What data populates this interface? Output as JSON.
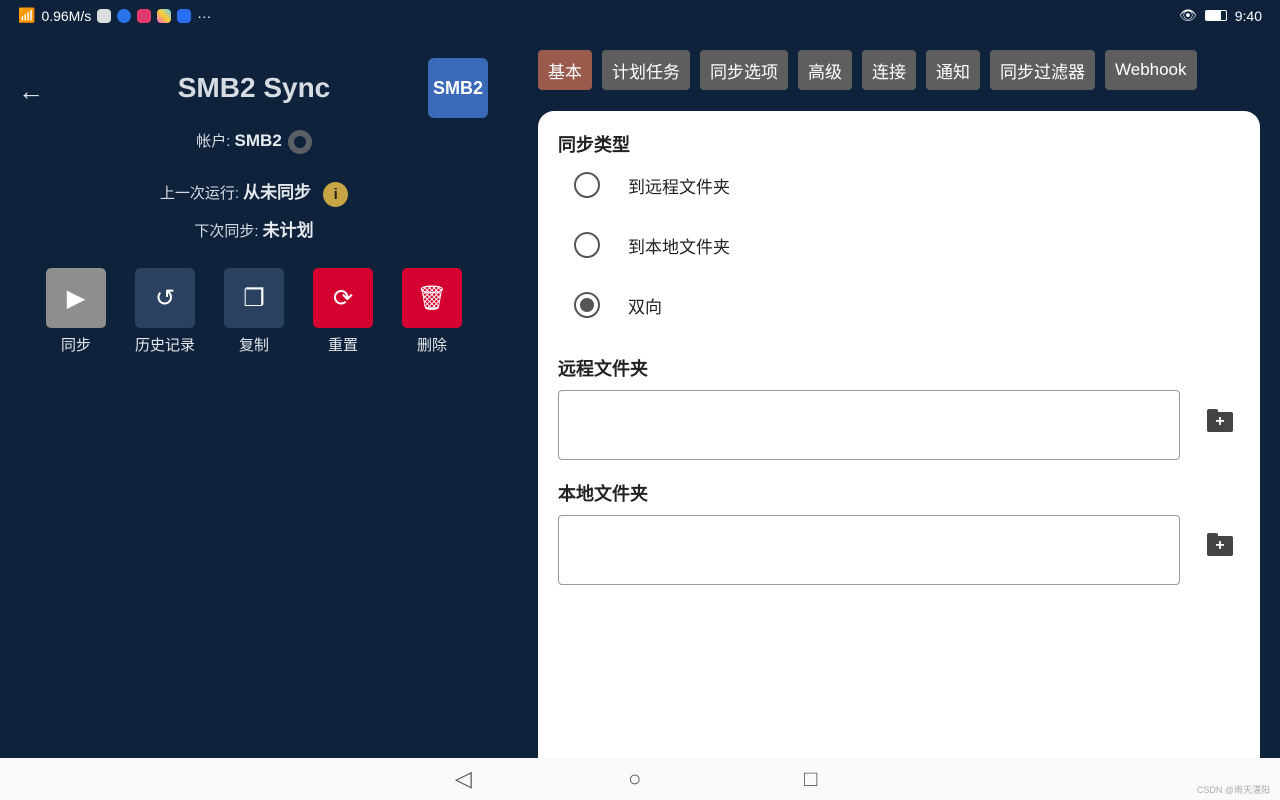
{
  "status": {
    "speed": "0.96M/s",
    "more": "···",
    "time": "9:40"
  },
  "header": {
    "title": "SMB2 Sync",
    "badge": "SMB2"
  },
  "account": {
    "label": "帐户:",
    "value": "SMB2"
  },
  "last_run": {
    "label": "上一次运行:",
    "value": "从未同步"
  },
  "next_sync": {
    "label": "下次同步:",
    "value": "未计划"
  },
  "actions": [
    {
      "label": "同步",
      "color": "#8e8e8e"
    },
    {
      "label": "历史记录",
      "color": "#2a4260"
    },
    {
      "label": "复制",
      "color": "#2a4260"
    },
    {
      "label": "重置",
      "color": "#d4002f"
    },
    {
      "label": "删除",
      "color": "#d4002f"
    }
  ],
  "tabs": [
    "基本",
    "计划任务",
    "同步选项",
    "高级",
    "连接",
    "通知",
    "同步过滤器",
    "Webhook"
  ],
  "form": {
    "sync_type_title": "同步类型",
    "options": [
      "到远程文件夹",
      "到本地文件夹",
      "双向"
    ],
    "selected": "双向",
    "remote_title": "远程文件夹",
    "remote_value": "",
    "local_title": "本地文件夹",
    "local_value": ""
  },
  "watermark": "CSDN @雨天湛阳"
}
